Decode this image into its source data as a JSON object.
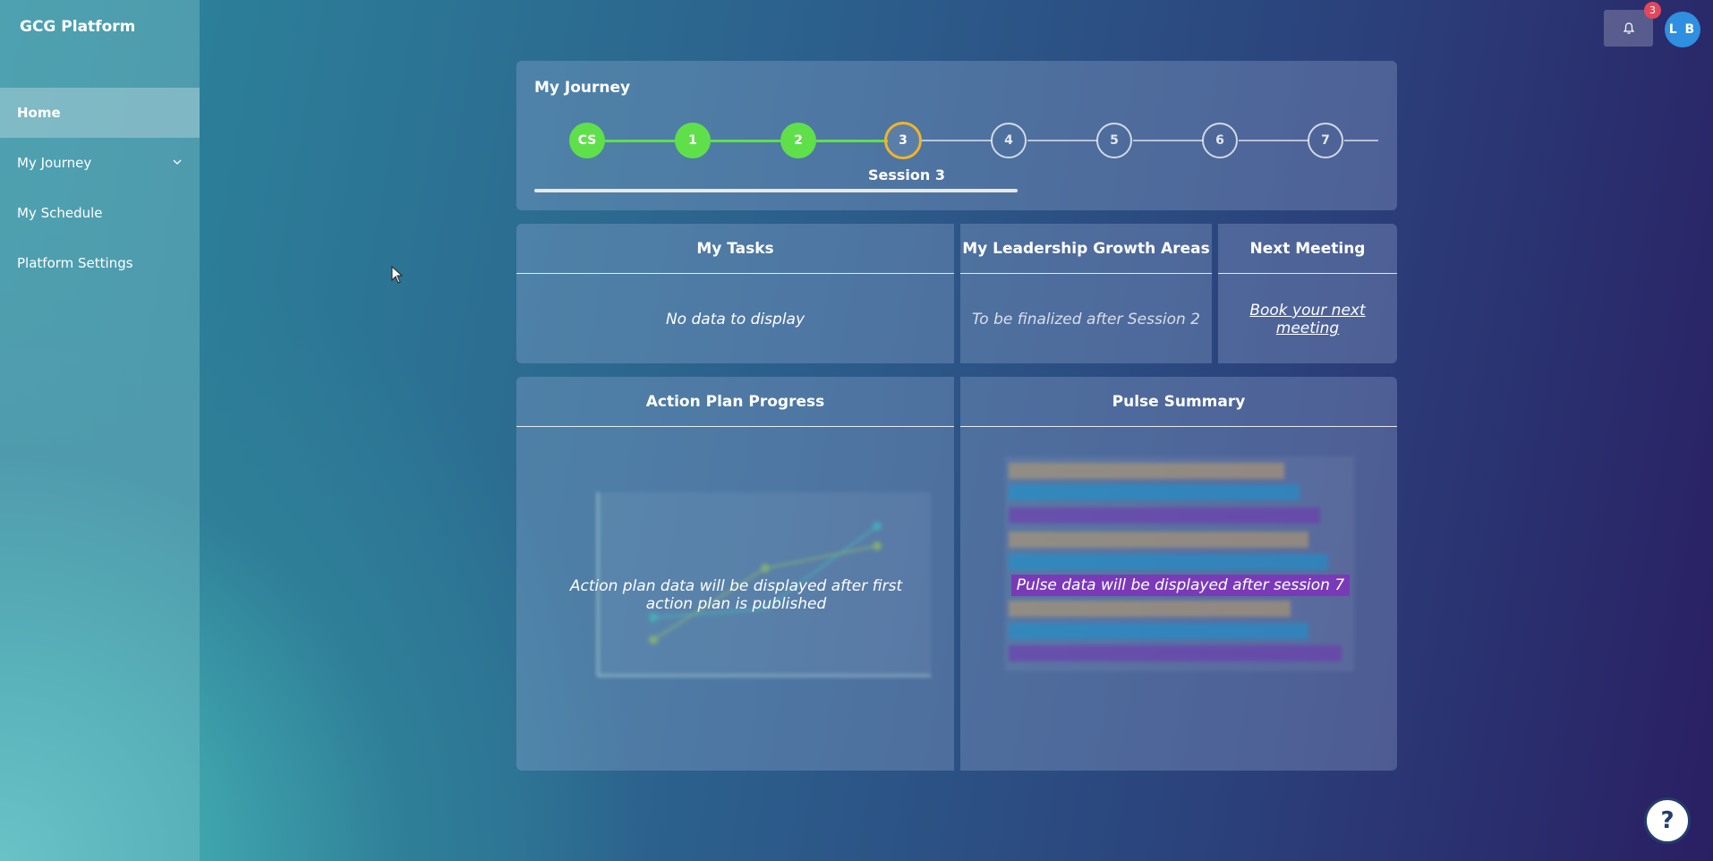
{
  "app": {
    "title": "GCG Platform"
  },
  "sidebar": {
    "items": [
      {
        "label": "Home"
      },
      {
        "label": "My Journey"
      },
      {
        "label": "My Schedule"
      },
      {
        "label": "Platform Settings"
      }
    ]
  },
  "topbar": {
    "notification_count": "3",
    "avatar_initials": "L B"
  },
  "journey": {
    "title": "My Journey",
    "steps": [
      "CS",
      "1",
      "2",
      "3",
      "4",
      "5",
      "6",
      "7"
    ],
    "current_label": "Session 3",
    "colors": {
      "done": "#5fe04a",
      "current": "#f0b429"
    }
  },
  "tasks": {
    "title": "My Tasks",
    "empty": "No data to display"
  },
  "growth": {
    "title": "My Leadership Growth Areas",
    "message": "To be finalized after Session 2"
  },
  "meeting": {
    "title": "Next Meeting",
    "link": "Book your next meeting"
  },
  "action_plan": {
    "title": "Action Plan Progress",
    "message": "Action plan data will be displayed after first action plan is published"
  },
  "pulse": {
    "title": "Pulse Summary",
    "message": "Pulse data will be displayed after session 7"
  },
  "help": {
    "label": "?"
  }
}
